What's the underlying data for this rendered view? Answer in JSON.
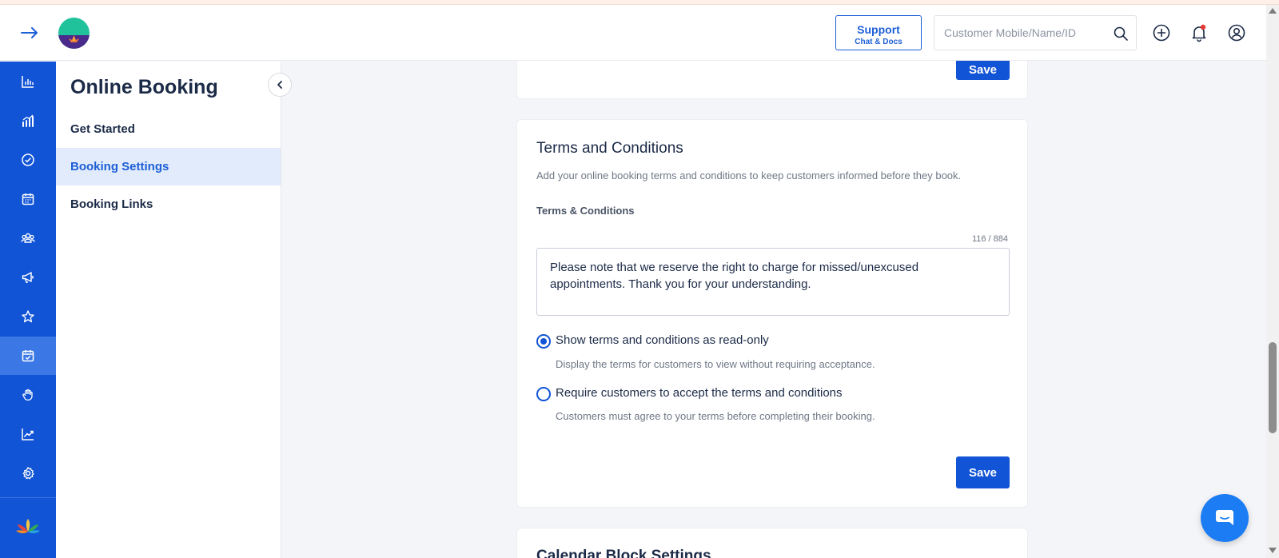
{
  "header": {
    "support_label": "Support",
    "support_sublabel": "Chat & Docs",
    "search_placeholder": "Customer Mobile/Name/ID"
  },
  "leftnav": {
    "items": [
      {
        "icon": "bar-chart-icon"
      },
      {
        "icon": "analytics-icon"
      },
      {
        "icon": "check-circle-icon"
      },
      {
        "icon": "calendar-icon"
      },
      {
        "icon": "clients-icon"
      },
      {
        "icon": "megaphone-icon"
      },
      {
        "icon": "star-icon"
      },
      {
        "icon": "calendar-check-icon",
        "active": true
      },
      {
        "icon": "hand-icon"
      },
      {
        "icon": "trend-icon"
      },
      {
        "icon": "gear-icon"
      }
    ]
  },
  "subnav": {
    "title": "Online Booking",
    "items": [
      {
        "label": "Get Started"
      },
      {
        "label": "Booking Settings",
        "active": true
      },
      {
        "label": "Booking Links"
      }
    ]
  },
  "top_card": {
    "save_label": "Save"
  },
  "terms": {
    "title": "Terms and Conditions",
    "description": "Add your online booking terms and conditions to keep customers informed before they book.",
    "field_label": "Terms & Conditions",
    "counter": "116 / 884",
    "text": "Please note that we reserve the right to charge for missed/unexcused appointments. Thank you for your understanding.",
    "option_readonly_label": "Show terms and conditions as read-only",
    "option_readonly_help": "Display the terms for customers to view without requiring acceptance.",
    "option_accept_label": "Require customers to accept the terms and conditions",
    "option_accept_help": "Customers must agree to your terms before completing their booking.",
    "selected_option": "read-only",
    "save_label": "Save"
  },
  "next_card": {
    "title": "Calendar Block Settings"
  },
  "colors": {
    "primary": "#1154d6",
    "nav_active": "#3b78e6",
    "chat_button": "#1c7cf3"
  }
}
